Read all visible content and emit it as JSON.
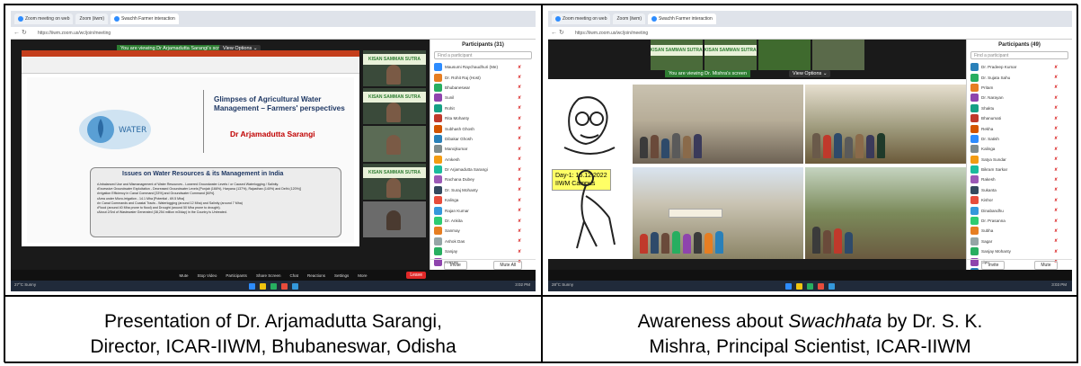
{
  "captions": {
    "left_line1": "Presentation of Dr. Arjamadutta Sarangi,",
    "left_line2": "Director, ICAR-IIWM, Bhubaneswar, Odisha",
    "right_line1_pre": "Awareness about ",
    "right_line1_em": "Swachhata",
    "right_line1_post": " by Dr. S. K.",
    "right_line2": "Mishra, Principal Scientist, ICAR-IIWM"
  },
  "left_screenshot": {
    "tabs": [
      "Zoom meeting on web",
      "Zoom (iiwm)",
      "Swachh Farmer interaction"
    ],
    "address": "https://iiwm.zoom.us/wc/join/meeting",
    "view_banner": "You are viewing Dr Arjamadutta Sarangi's screen",
    "view_options": "View Options ⌄",
    "slide": {
      "logo_text": "WATER",
      "title": "Glimpses of Agricultural Water Management – Farmers' perspectives",
      "author": "Dr Arjamadutta Sarangi",
      "issues_heading": "Issues on Water Resources & its Management in India",
      "issues": [
        "Unbalanced Use and Mismanagement of Water Resources - Lowered Groundwater Levels / or Caused Waterlogging / Salinity.",
        "Excessive Groundwater Exploitation - Decreased Groundwater Levels [Punjab (166%), Haryana (137%), Rajasthan (140%) and Delhi (120%)]",
        "Irrigation Efficiency in Canal Command [33%] and Groundwater Command [60%].",
        "Area under Micro-irrigation - 14.1 Mha [Potential - 69.5 Mha]",
        "In Canal Commands and Coastal Tracts - Waterlogging (around 12 Mha) and Salinity (around 7 Mha)",
        "Flood (around 40 Mha prone to flood) and Drought (around 50 Mha prone to drought).",
        "About 2/3rd of Wastewater Generated (38,254 million m3/day) in the Country is Untreated."
      ]
    },
    "tile_banner": "KISAN SAMMAN SUTRA",
    "participants_title": "Participants (31)",
    "search_placeholder": "Find a participant",
    "participants": [
      "Mausumi Raychaudhuri (Me)",
      "Dr. Rohit Raj (Host)",
      "Bhubaneswar",
      "Sunil",
      "Rohit",
      "Rita Mohanty",
      "Subhash Ghosh",
      "Dibakar Ghosh",
      "Manojkumar",
      "Amkesh",
      "Dr Arjamadutta Sarangi",
      "Rachana Dubey",
      "Dr. Suraj Mohanty",
      "Kalinga",
      "Rajan Kumar",
      "Dr. Ankita",
      "Sanmay",
      "Ashok Das",
      "Sanjay",
      "Hanger"
    ],
    "participant_colors": [
      "#2d8cff",
      "#e67e22",
      "#27ae60",
      "#8e44ad",
      "#16a085",
      "#c0392b",
      "#d35400",
      "#2980b9",
      "#7f8c8d",
      "#f39c12",
      "#1abc9c",
      "#9b59b6",
      "#34495e",
      "#e74c3c",
      "#3498db",
      "#2ecc71",
      "#e67e22",
      "#95a5a6",
      "#27ae60",
      "#8e44ad"
    ],
    "invite_label": "Invite",
    "mute_all_label": "Mute All",
    "toolbar": [
      "Mute",
      "Stop Video",
      "Participants",
      "Share Screen",
      "Chat",
      "Reactions",
      "Settings",
      "More"
    ],
    "end_label": "Leave",
    "weather": "27°C Sunny",
    "clock": "3:02 PM"
  },
  "right_screenshot": {
    "tabs": [
      "Zoom meeting on web",
      "Zoom (iiwm)",
      "Swachh Farmer interaction"
    ],
    "address": "https://iiwm.zoom.us/wc/join/meeting",
    "view_banner": "You are viewing Dr. Mishra's screen",
    "view_options": "View Options ⌄",
    "tile_banner": "KISAN SAMMAN SUTRA",
    "day_line1": "Day-1: 16.12.2022",
    "day_line2": "IIWM Campus",
    "participants_title": "Participants (49)",
    "search_placeholder": "Find a participant",
    "participants": [
      "Dr. Pradeep Kumar",
      "Dr. Sujata Sahu",
      "Pritam",
      "Dr. Narayan",
      "Shaktu",
      "Bhanumati",
      "Rekha",
      "Dr. Satish",
      "Kalinga",
      "Satya Sundar",
      "Bikram Sarkar",
      "Rakesh",
      "Sukanta",
      "Kishor",
      "Dinabandhu",
      "Dr. Prasanna",
      "Subha",
      "Sagar",
      "Sanjay Mohanty",
      "Lipu",
      "Abhishek"
    ],
    "participant_colors": [
      "#2980b9",
      "#27ae60",
      "#e67e22",
      "#8e44ad",
      "#16a085",
      "#c0392b",
      "#d35400",
      "#2d8cff",
      "#7f8c8d",
      "#f39c12",
      "#1abc9c",
      "#9b59b6",
      "#34495e",
      "#e74c3c",
      "#3498db",
      "#2ecc71",
      "#e67e22",
      "#95a5a6",
      "#27ae60",
      "#8e44ad",
      "#2980b9"
    ],
    "invite_label": "Invite",
    "mute_all_label": "Mute",
    "weather": "28°C Sunny",
    "clock": "3:03 PM"
  }
}
